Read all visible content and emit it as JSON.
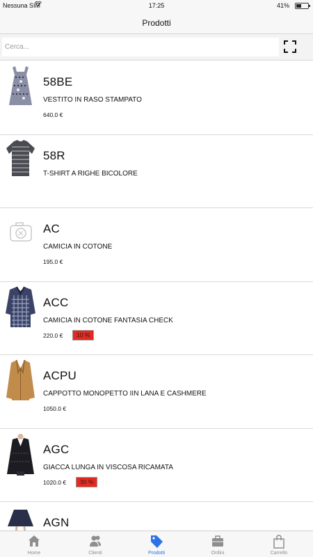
{
  "status_bar": {
    "carrier": "Nessuna SIM",
    "time": "17:25",
    "battery": "41%"
  },
  "header": {
    "title": "Prodotti"
  },
  "search": {
    "placeholder": "Cerca...",
    "value": ""
  },
  "products": [
    {
      "code": "58BE",
      "description": "VESTITO IN RASO STAMPATO",
      "price": "640.0 €",
      "discount": "",
      "image": "dress-photo"
    },
    {
      "code": "58R",
      "description": "T-SHIRT A RIGHE BICOLORE",
      "price": "",
      "discount": "",
      "image": "tshirt-photo"
    },
    {
      "code": "AC",
      "description": "CAMICIA IN COTONE",
      "price": "195.0 €",
      "discount": "",
      "image": "camera-placeholder-icon"
    },
    {
      "code": "ACC",
      "description": "CAMICIA IN COTONE FANTASIA CHECK",
      "price": "220.0 €",
      "discount": "10 %",
      "image": "check-shirt-photo"
    },
    {
      "code": "ACPU",
      "description": "CAPPOTTO MONOPETTO IIN LANA E CASHMERE",
      "price": "1050.0 €",
      "discount": "",
      "image": "coat-photo"
    },
    {
      "code": "AGC",
      "description": "GIACCA LUNGA IN VISCOSA RICAMATA",
      "price": "1020.0 €",
      "discount": "30 %",
      "image": "jacket-photo"
    },
    {
      "code": "AGN",
      "description": "",
      "price": "",
      "discount": "",
      "image": "skirt-photo"
    }
  ],
  "tabs": [
    {
      "label": "Home",
      "icon": "home-icon",
      "active": false
    },
    {
      "label": "Clienti",
      "icon": "customers-icon",
      "active": false
    },
    {
      "label": "Prodotti",
      "icon": "tag-icon",
      "active": true
    },
    {
      "label": "Ordini",
      "icon": "briefcase-icon",
      "active": false
    },
    {
      "label": "Carrello",
      "icon": "shopping-bag-icon",
      "active": false
    }
  ],
  "colors": {
    "accent": "#2d73e6",
    "discount_badge": "#e5291f",
    "tab_inactive": "#8e8e8e"
  }
}
